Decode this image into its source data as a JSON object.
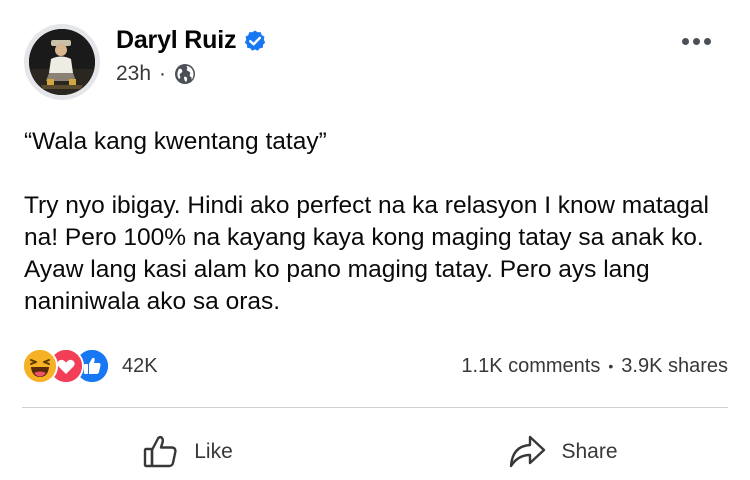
{
  "post": {
    "author": {
      "name": "Daryl Ruiz",
      "verified": true,
      "avatar_icon": "profile-photo"
    },
    "meta": {
      "timestamp": "23h",
      "separator": "·",
      "audience_icon": "globe-icon"
    },
    "more_icon": "more-horizontal-icon",
    "text": {
      "quote": "“Wala kang kwentang tatay”",
      "paragraph": "Try nyo ibigay. Hindi ako perfect na ka relasyon I know matagal na! Pero 100% na kayang kaya kong maging tatay sa anak ko. Ayaw lang kasi alam ko pano maging tatay. Pero ays lang naniniwala ako sa oras."
    },
    "reactions": {
      "types": [
        "haha",
        "love",
        "like"
      ],
      "count": "42K"
    },
    "stats": {
      "comments": "1.1K comments",
      "separator": "•",
      "shares": "3.9K shares"
    },
    "actions": {
      "like_label": "Like",
      "share_label": "Share"
    }
  },
  "colors": {
    "verified_blue": "#1877f2",
    "haha_yellow": "#f7b125",
    "love_red": "#f33e58",
    "like_blue": "#1877f2",
    "secondary_text": "#383838",
    "divider": "#ced0d4"
  }
}
